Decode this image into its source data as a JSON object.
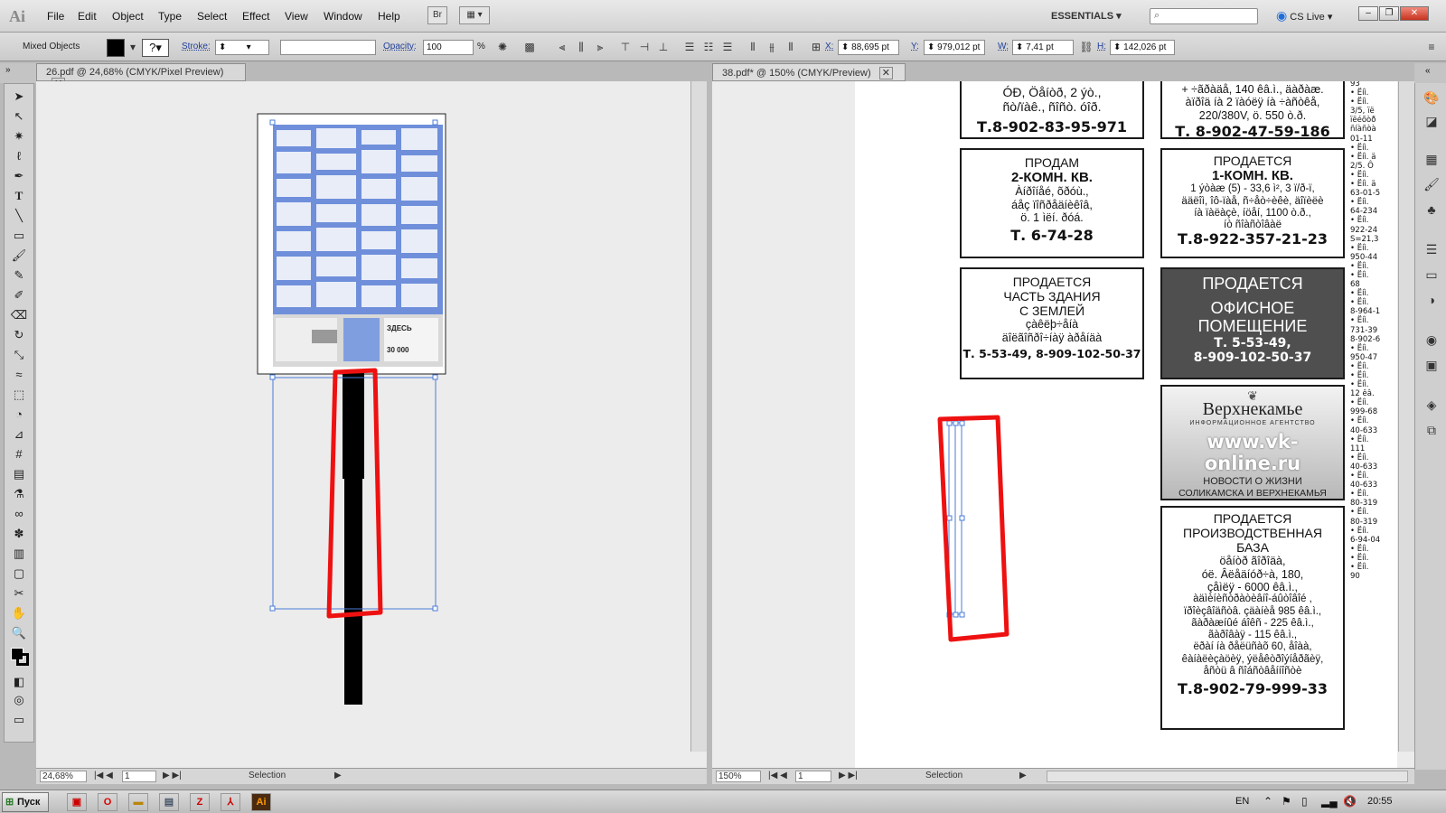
{
  "app": {
    "logo": "Ai"
  },
  "menu": [
    "File",
    "Edit",
    "Object",
    "Type",
    "Select",
    "Effect",
    "View",
    "Window",
    "Help"
  ],
  "toolbar_buttons": {
    "bridge": "Br"
  },
  "workspace": {
    "label": "ESSENTIALS",
    "cslive": "CS Live"
  },
  "control": {
    "selection_type": "Mixed Objects",
    "stroke_label": "Stroke:",
    "opacity_label": "Opacity:",
    "opacity_value": "100",
    "percent": "%",
    "x_label": "X:",
    "x_value": "88,695 pt",
    "y_label": "Y:",
    "y_value": "979,012 pt",
    "w_label": "W:",
    "w_value": "7,41 pt",
    "h_label": "H:",
    "h_value": "142,026 pt"
  },
  "docs": [
    {
      "tab": "26.pdf @ 24,68% (CMYK/Pixel Preview)",
      "zoom": "24,68%",
      "page": "1",
      "status": "Selection"
    },
    {
      "tab": "38.pdf* @ 150% (CMYK/Preview)",
      "zoom": "150%",
      "page": "1",
      "status": "Selection"
    }
  ],
  "ads": {
    "top_left": {
      "line1": "ÓÐ, Öåíòð, 2 ýò.,",
      "line2": "ñò/ïàê., ñîñò. óîð.",
      "phone": "Т.8-902-83-95-971"
    },
    "top_right": {
      "line1": "+ ÷ãðàäå, 140 êâ.ì., äàðàæ.",
      "line2": "àïðîä íà 2 ïàóëÿ íà ÷àñòêå,",
      "line3": "220/380V, ö. 550 ò.ð.",
      "phone": "Т. 8-902-47-59-186"
    },
    "ad2": {
      "head": "ПРОДАМ",
      "title": "2-КОМН. КВ.",
      "l1": "Àíðîíåé, õðóù.,",
      "l2": "áåç ïîñðåäíèêîâ,",
      "l3": "ö. 1 ìëí. ðóá.",
      "phone": "Т. 6-74-28"
    },
    "ad3": {
      "head": "ПРОДАЕТСЯ",
      "title": "1-КОМН. КВ.",
      "l1": "1 ýòàæ (5) - 33,6 ì², 3 ï/ð-ï,",
      "l2": "ääëîì, îô-ïàå, ñ÷åò÷èêè, äîïèëè",
      "l3": "íà ïàëàçè, íöåí, 1100 ò.ð.,",
      "l4": "íò ñîàñòîâàë",
      "phone": "Т.8-922-357-21-23"
    },
    "ad4": {
      "l1": "ПРОДАЕТСЯ",
      "l2": "ЧАСТЬ ЗДАНИЯ",
      "l3": "С ЗЕМЛЕЙ",
      "l4": "çàêëþ÷åíà",
      "l5": "äîëãîñðî÷íàÿ àðåíäà",
      "phone": "Т. 5-53-49, 8-909-102-50-37"
    },
    "ad5": {
      "l1": "ПРОДАЕТСЯ",
      "l2": "ОФИСНОЕ",
      "l3": "ПОМЕЩЕНИЕ",
      "p1": "Т. 5-53-49,",
      "p2": "8-909-102-50-37"
    },
    "ad6": {
      "brand": "Верхнекамье",
      "sub": "ИНФОРМАЦИОННОЕ АГЕНТСТВО",
      "url": "www.vk-online.ru",
      "n1": "НОВОСТИ О ЖИЗНИ",
      "n2": "СОЛИКАМСКА И ВЕРХНЕКАМЬЯ"
    },
    "ad7": {
      "l1": "ПРОДАЕТСЯ",
      "l2": "ПРОИЗВОДСТВЕННАЯ",
      "l3": "БАЗА",
      "l4": "öåíòð ãîðîäà,",
      "l5": "óë. Âëåäíóð÷à, 180,",
      "l6": "çåìëÿ - 6000 êâ.ì.,",
      "l7": "àäìèíèñòðàòèâíî-áûòîâîé ,",
      "l8": "ïðîèçâîäñòâ. çäàíèå 985 êâ.ì.,",
      "l9": "ãàðàæíûé áîêñ - 225 êâ.ì.,",
      "l10": "ãàðîâàÿ - 115 êâ.ì.,",
      "l11": "ëðàí íà ðåëüñàõ 60, åîàà,",
      "l12": "êàíàëèçàöèÿ, ýëåêòðîýíåðãèÿ,",
      "l13": "åñòü â ñîáñòâåííîñòè",
      "phone": "Т.8-902-79-999-33"
    }
  },
  "side_column": [
    "93",
    "• Ëíì.",
    "• Ëíì.",
    "3/5, ïë",
    "ïëéõòð",
    "ñíàñòà",
    "01-11",
    "• Ëíì.",
    "• Ëíì. ä",
    "2/5. Ô",
    "• Ëíì.",
    "• Ëíì. ä",
    "63-01-5",
    "• Ëíì.",
    "64-234",
    "• Ëíì.",
    "922-24",
    "S=21,3",
    "• Ëíì.",
    "950-44",
    "• Ëíì.",
    "• Ëíì.",
    "68",
    "• Ëíì.",
    "• Ëíì.",
    "8-964-1",
    "• Ëíì.",
    "731-39",
    "8-902-6",
    "• Ëíì.",
    "950-47",
    "• Ëíì.",
    "• Ëíì.",
    "• Ëíì.",
    "12 êâ.",
    "• Ëíì.",
    "999-68",
    "• Ëíì.",
    "40-633",
    "• Ëíì.",
    "111",
    "• Ëíì.",
    "40-633",
    "• Ëíì.",
    "40-633",
    "• Ëíì.",
    "80-319",
    "• Ëíì.",
    "80-319",
    "• Ëíì.",
    "6-94-04",
    "• Ëíì.",
    "• Ëíì.",
    "• Ëíì.",
    "90"
  ],
  "thumb_texts": {
    "zdes": "ЗДЕСЬ",
    "num": "30 000"
  },
  "taskbar": {
    "start": "Пуск",
    "lang": "EN",
    "clock": "20:55"
  },
  "colors": {
    "selection": "#4a7bd8",
    "annotation": "#ee1111",
    "dark_ad": "#4f4f4f"
  }
}
